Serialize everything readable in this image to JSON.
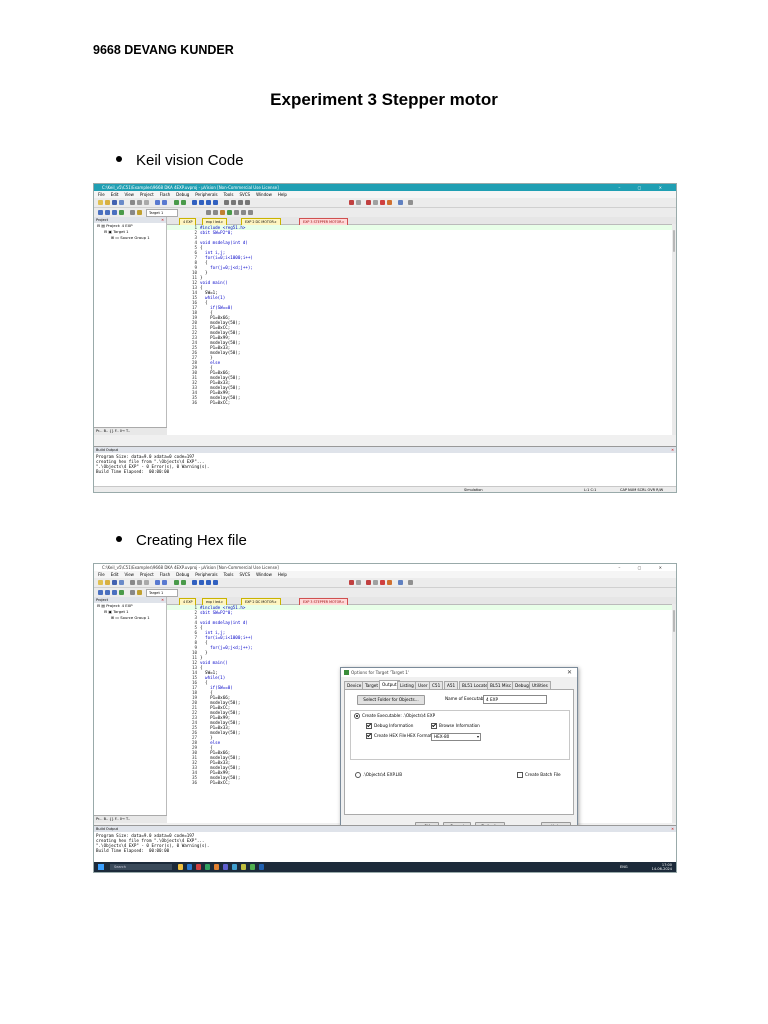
{
  "doc": {
    "author": "9668 DEVANG KUNDER",
    "title": "Experiment 3 Stepper motor",
    "bullet1": "Keil vision Code",
    "bullet2": "Creating Hex file"
  },
  "ide": {
    "window_title": "C:\\Keil_v5\\C51\\Examples\\9668 DKA 4EXP.uvproj - µVision  [Non-Commercial Use License]",
    "menu": [
      "File",
      "Edit",
      "View",
      "Project",
      "Flash",
      "Debug",
      "Peripherals",
      "Tools",
      "SVCS",
      "Window",
      "Help"
    ],
    "target_select": "Target 1",
    "project_pane_title": "Project",
    "tree": [
      "Project: 4 EXP",
      "Target 1",
      "Source Group 1"
    ],
    "project_tabs": "Pr...  B..  {} F..  0→ T..",
    "editor_tabs": [
      "4 EXP",
      "exp I led.c",
      "EXP 2 DC MOTOR.c",
      "EXP 3 STEPPER MOTOR.c"
    ],
    "build_title": "Build Output",
    "build_output_1": [
      "Program Size: data=9.0 xdata=0 code=197",
      "creating hex file from \".\\Objects\\4 EXP\"...",
      "\".\\Objects\\4 EXP\" - 0 Error(s), 0 Warning(s).",
      "Build Time Elapsed:  00:00:00"
    ],
    "build_output_2": [
      "Program Size: data=9.0 xdata=0 code=197",
      "creating hex file from \".\\Objects\\4 EXP\"...",
      "\".\\Objects\\4 EXP\" - 0 Error(s), 0 Warning(s).",
      "Build Time Elapsed:  00:00:00"
    ],
    "status_sim": "Simulation",
    "status_pos": "L:1 C:1",
    "status_caps": "CAP  NUM  SCRL  OVR  R/W"
  },
  "code_lines": [
    "#include <reg51.h>",
    "sbit SW=P2^0;",
    "",
    "void msdelay(int d)",
    "{",
    "  int i,j;",
    "  for(i=0;i<1000;i++)",
    "  {",
    "    for(j=0;j<d;j++);",
    "  }",
    "}",
    "void main()",
    "{",
    "  SW=1;",
    "  while(1)",
    "  {",
    "    if(SW==0)",
    "    {",
    "    P1=0x66;",
    "    msdelay(50);",
    "    P1=0xCC;",
    "    msdelay(50);",
    "    P1=0x99;",
    "    msdelay(50);",
    "    P1=0x33;",
    "    msdelay(50);",
    "    }",
    "    else",
    "    {",
    "    P1=0x66;",
    "    msdelay(50);",
    "    P1=0x33;",
    "    msdelay(50);",
    "    P1=0x99;",
    "    msdelay(50);",
    "    P1=0xCC;"
  ],
  "dialog": {
    "title": "Options for Target 'Target 1'",
    "tabs": [
      "Device",
      "Target",
      "Output",
      "Listing",
      "User",
      "C51",
      "A51",
      "BL51 Locate",
      "BL51 Misc",
      "Debug",
      "Utilities"
    ],
    "select_folder": "Select Folder for Objects...",
    "name_label": "Name of Executable:",
    "name_value": "4 EXP",
    "create_exec": "Create Executable:  .\\Objects\\4 EXP",
    "debug_info": "Debug Information",
    "browse_info": "Browse Information",
    "create_hex": "Create HEX File",
    "hex_format_label": "HEX Format:",
    "hex_format_value": "HEX-80",
    "create_lib": ".\\Objects\\4 EXP.LIB",
    "create_batch": "Create Batch File",
    "ok": "OK",
    "cancel": "Cancel",
    "defaults": "Defaults",
    "help": "Help"
  },
  "taskbar": {
    "search": "Search",
    "lang": "ENG",
    "time": "17:00",
    "date": "14-06-2024"
  }
}
